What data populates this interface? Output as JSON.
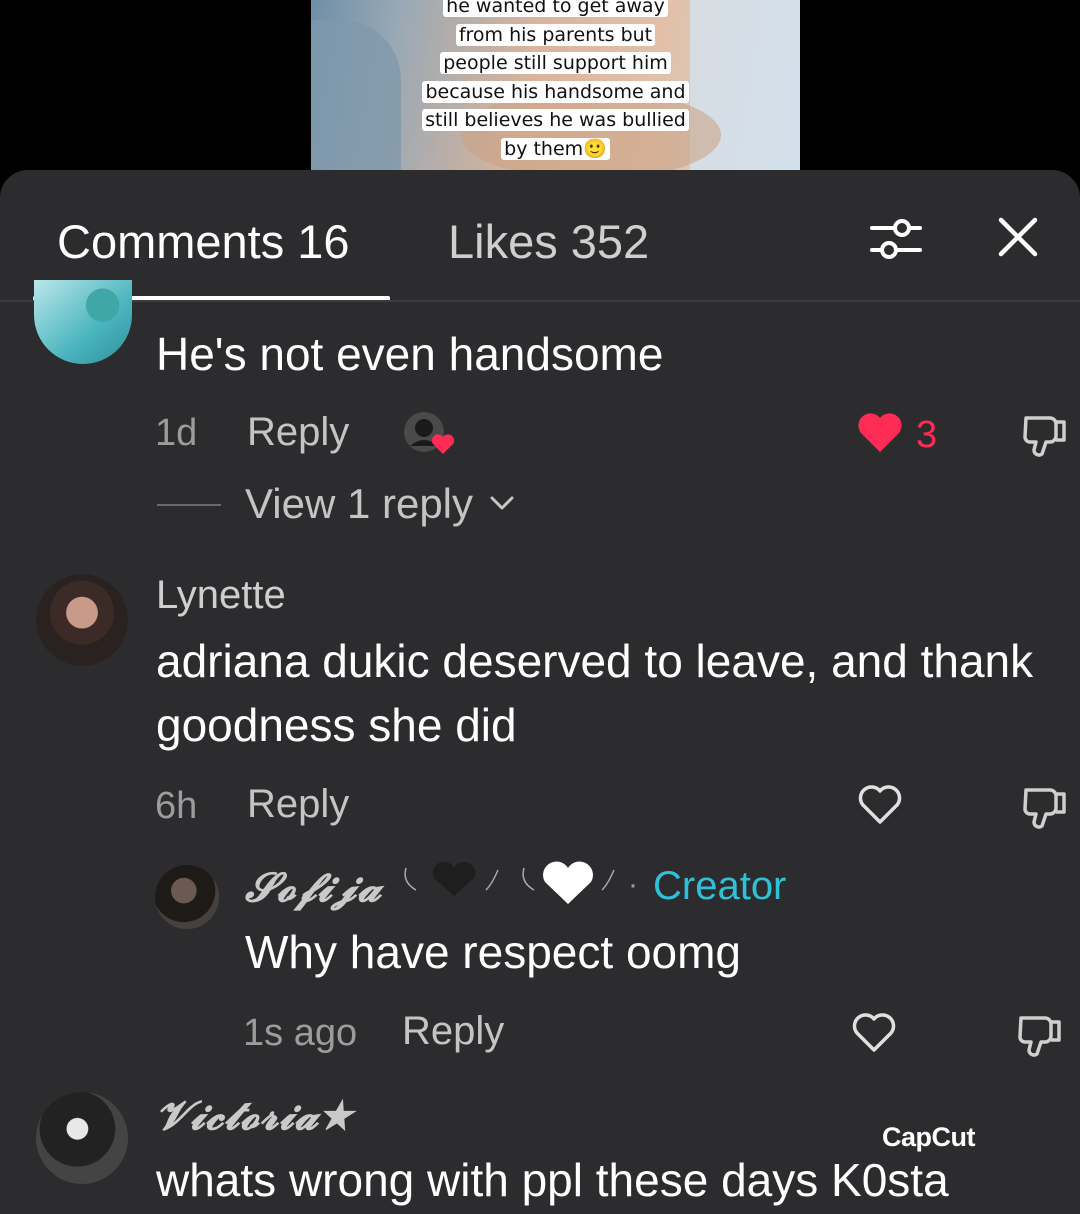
{
  "video": {
    "overlay_lines": [
      "he wanted to get away",
      "from his parents but",
      "people still support him",
      "because his handsome and",
      "still believes he was bullied",
      "by them🙂"
    ]
  },
  "tabs": {
    "comments_label": "Comments 16",
    "likes_label": "Likes 352",
    "active": "comments"
  },
  "icons": {
    "filter": "filter-sliders-icon",
    "close": "close-icon",
    "like": "heart-icon",
    "dislike": "thumbs-down-icon"
  },
  "colors": {
    "panel": "#2c2c2e",
    "like_active": "#fe2c55",
    "creator": "#2ec2d6"
  },
  "comments": [
    {
      "author": "",
      "text": "He's not even handsome",
      "time": "1d",
      "reply_label": "Reply",
      "liked": true,
      "like_count": "3",
      "creator_liked": true,
      "view_replies": "View 1 reply"
    },
    {
      "author": "Lynette",
      "text": "adriana dukic deserved to leave, and thank goodness she did",
      "time": "6h",
      "reply_label": "Reply",
      "liked": false
    },
    {
      "author": "𝓢𝓸𝓯𝓲𝓳𝓪",
      "badge": "Creator",
      "text": "Why have respect oomg",
      "time": "1s ago",
      "reply_label": "Reply",
      "liked": false,
      "is_reply": true
    },
    {
      "author": "𝓥𝓲𝓬𝓽𝓸𝓻𝓲𝓪★",
      "text": "whats wrong with ppl these days K0sta"
    }
  ],
  "watermark": "CapCut"
}
